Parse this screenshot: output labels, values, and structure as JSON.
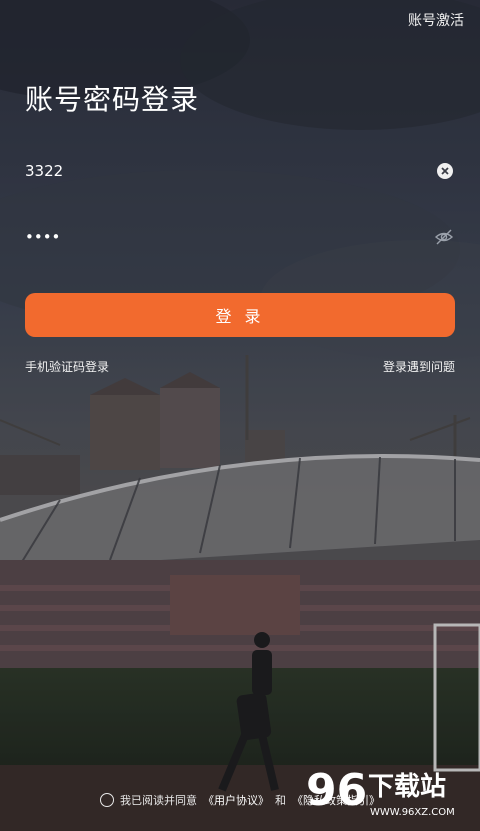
{
  "header": {
    "activate_label": "账号激活"
  },
  "title": "账号密码登录",
  "username": {
    "value": "3322"
  },
  "password": {
    "value": "••••"
  },
  "login_button": {
    "label": "登 录"
  },
  "links": {
    "sms_login": "手机验证码登录",
    "problem": "登录遇到问题"
  },
  "agreement": {
    "text": "我已阅读并同意",
    "user_agreement": "《用户协议》",
    "and": "和",
    "privacy": "《隐私政策指引》"
  },
  "watermark": {
    "brand": "下载站",
    "number": "96",
    "url": "WWW.96XZ.COM"
  },
  "colors": {
    "accent": "#f26a2e"
  }
}
